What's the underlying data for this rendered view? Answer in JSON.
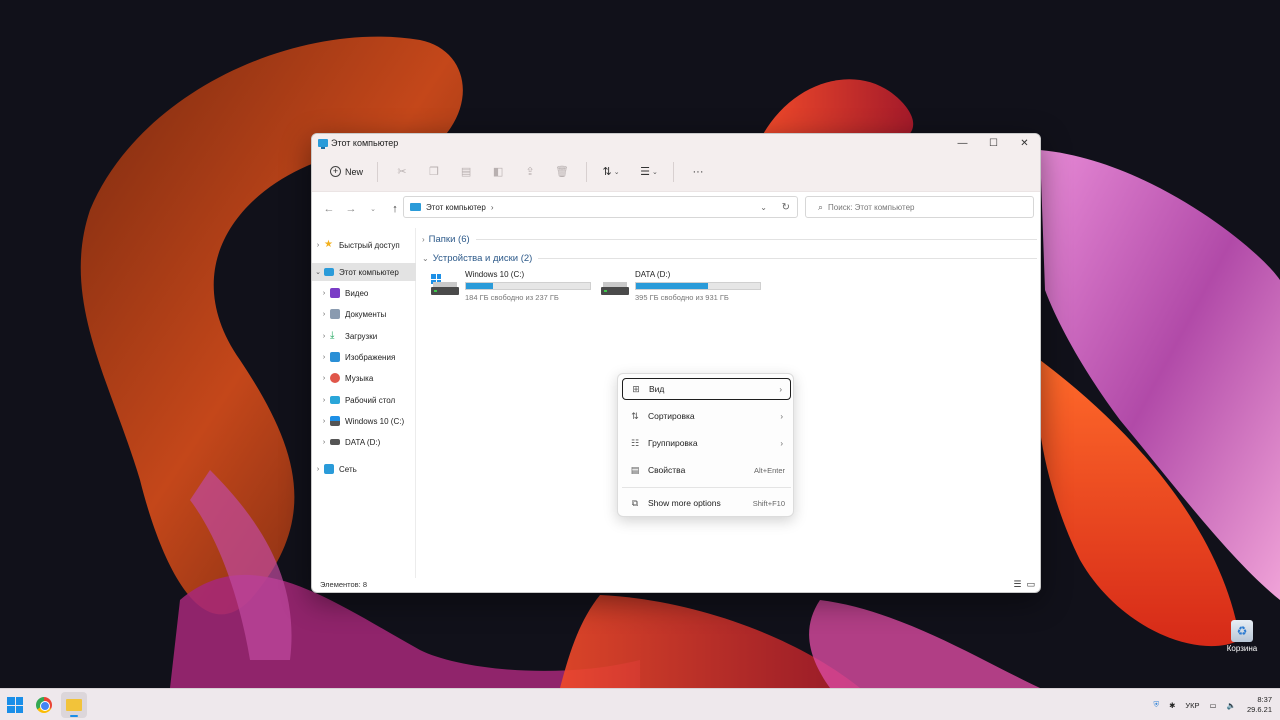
{
  "window": {
    "title": "Этот компьютер",
    "controls": {
      "minimize": "—",
      "maximize": "☐",
      "close": "✕"
    }
  },
  "toolbar": {
    "new_label": "New",
    "more": "···"
  },
  "address_bar": {
    "location": "Этот компьютер",
    "chevron": "›",
    "dropdown": "⌄",
    "refresh": "↻"
  },
  "search": {
    "placeholder": "Поиск: Этот компьютер"
  },
  "sidebar": {
    "items": [
      {
        "label": "Быстрый доступ"
      },
      {
        "label": "Этот компьютер"
      },
      {
        "label": "Видео"
      },
      {
        "label": "Документы"
      },
      {
        "label": "Загрузки"
      },
      {
        "label": "Изображения"
      },
      {
        "label": "Музыка"
      },
      {
        "label": "Рабочий стол"
      },
      {
        "label": "Windows 10 (C:)"
      },
      {
        "label": "DATA (D:)"
      },
      {
        "label": "Сеть"
      }
    ]
  },
  "groups": {
    "folders": "Папки (6)",
    "devices": "Устройства и диски (2)"
  },
  "drives": [
    {
      "name": "Windows 10 (C:)",
      "free_text": "184 ГБ свободно из 237 ГБ",
      "used_fraction": 0.22
    },
    {
      "name": "DATA (D:)",
      "free_text": "395 ГБ свободно из 931 ГБ",
      "used_fraction": 0.58
    }
  ],
  "status_bar": {
    "items_count": "Элементов: 8"
  },
  "context_menu": {
    "items": [
      {
        "label": "Вид",
        "shortcut": ""
      },
      {
        "label": "Сортировка",
        "shortcut": ""
      },
      {
        "label": "Группировка",
        "shortcut": ""
      },
      {
        "label": "Свойства",
        "shortcut": "Alt+Enter"
      },
      {
        "label": "Show more options",
        "shortcut": "Shift+F10"
      }
    ]
  },
  "desktop": {
    "recycle_bin": "Корзина"
  },
  "taskbar": {
    "language": "УКР",
    "time": "8:37",
    "date": "29.6.21"
  },
  "colors": {
    "accent": "#2a9bd9",
    "taskbar": "#eee8ec",
    "window_chrome": "#f4eeee"
  }
}
